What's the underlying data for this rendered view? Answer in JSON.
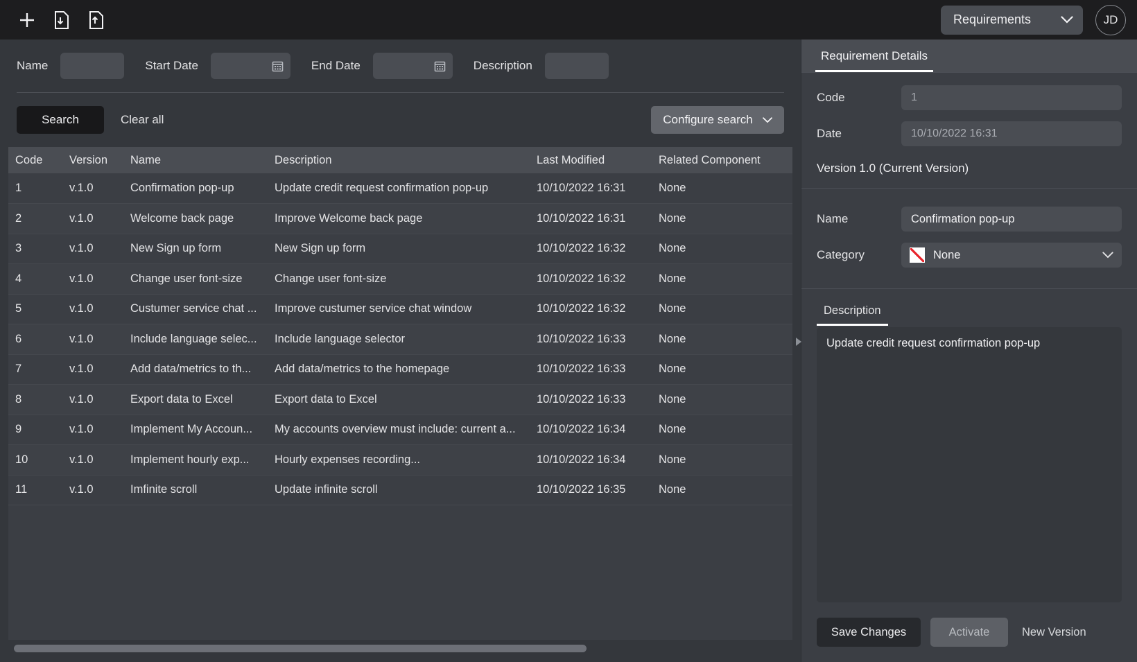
{
  "topbar": {
    "icons": [
      {
        "name": "add-icon",
        "label": "New"
      },
      {
        "name": "import-file-icon",
        "label": "Import"
      },
      {
        "name": "export-file-icon",
        "label": "Export"
      }
    ],
    "module_selected": "Requirements",
    "module_chevron": "chevron-down-icon",
    "avatar_initials": "JD"
  },
  "filters": {
    "name_label": "Name",
    "name_value": "",
    "name_placeholder": "",
    "start_date_label": "Start Date",
    "start_date_value": "",
    "start_date_placeholder": "",
    "end_date_label": "End Date",
    "end_date_value": "",
    "end_date_placeholder": "",
    "description_label": "Description",
    "description_value": "",
    "description_placeholder": "",
    "calendar_icon": "calendar-icon"
  },
  "actions": {
    "search_label": "Search",
    "clear_all_label": "Clear all",
    "configure_search_label": "Configure search",
    "configure_chevron": "chevron-down-icon"
  },
  "table": {
    "columns": [
      "Code",
      "Version",
      "Name",
      "Description",
      "Last Modified",
      "Related Component"
    ],
    "rows": [
      {
        "code": "1",
        "version": "v.1.0",
        "name": "Confirmation pop-up",
        "description": "Update credit request confirmation pop-up",
        "modified": "10/10/2022 16:31",
        "related": "None"
      },
      {
        "code": "2",
        "version": "v.1.0",
        "name": "Welcome back page",
        "description": "Improve Welcome back page",
        "modified": "10/10/2022 16:31",
        "related": "None"
      },
      {
        "code": "3",
        "version": "v.1.0",
        "name": "New Sign up form",
        "description": "New Sign up form",
        "modified": "10/10/2022 16:32",
        "related": "None"
      },
      {
        "code": "4",
        "version": "v.1.0",
        "name": "Change user font-size",
        "description": "Change user font-size",
        "modified": "10/10/2022 16:32",
        "related": "None"
      },
      {
        "code": "5",
        "version": "v.1.0",
        "name": "Custumer service chat ...",
        "description": "Improve custumer service chat window",
        "modified": "10/10/2022 16:32",
        "related": "None"
      },
      {
        "code": "6",
        "version": "v.1.0",
        "name": "Include language selec...",
        "description": "Include language selector",
        "modified": "10/10/2022 16:33",
        "related": "None"
      },
      {
        "code": "7",
        "version": "v.1.0",
        "name": "Add data/metrics to th...",
        "description": "Add data/metrics to the homepage",
        "modified": "10/10/2022 16:33",
        "related": "None"
      },
      {
        "code": "8",
        "version": "v.1.0",
        "name": "Export data to Excel",
        "description": "Export data to Excel",
        "modified": "10/10/2022 16:33",
        "related": "None"
      },
      {
        "code": "9",
        "version": "v.1.0",
        "name": "Implement My Accoun...",
        "description": "My accounts overview must include: current a...",
        "modified": "10/10/2022 16:34",
        "related": "None"
      },
      {
        "code": "10",
        "version": "v.1.0",
        "name": "Implement hourly exp...",
        "description": "Hourly expenses recording...",
        "modified": "10/10/2022 16:34",
        "related": "None"
      },
      {
        "code": "11",
        "version": "v.1.0",
        "name": "Imfinite scroll",
        "description": "Update infinite scroll",
        "modified": "10/10/2022 16:35",
        "related": "None"
      }
    ]
  },
  "panel": {
    "tab_label": "Requirement Details",
    "code_label": "Code",
    "code_value": "1",
    "date_label": "Date",
    "date_value": "10/10/2022 16:31",
    "version_text": "Version 1.0 (Current Version)",
    "name_label": "Name",
    "name_value": "Confirmation pop-up",
    "category_label": "Category",
    "category_value": "None",
    "category_swatch": "none-color-swatch",
    "category_chevron": "chevron-down-icon",
    "description_tab_label": "Description",
    "description_value": "Update credit request confirmation pop-up",
    "save_label": "Save Changes",
    "activate_label": "Activate",
    "new_version_label": "New Version",
    "collapse_icon": "collapse-panel-arrow-icon"
  },
  "colors": {
    "topbar_bg": "#1d1d1f",
    "panel_bg": "#3b3e44",
    "surface": "#34373c",
    "field": "#4a4d53",
    "accent_white": "#ffffff",
    "category_none_red": "#e8242c",
    "search_btn": "#18181a"
  }
}
